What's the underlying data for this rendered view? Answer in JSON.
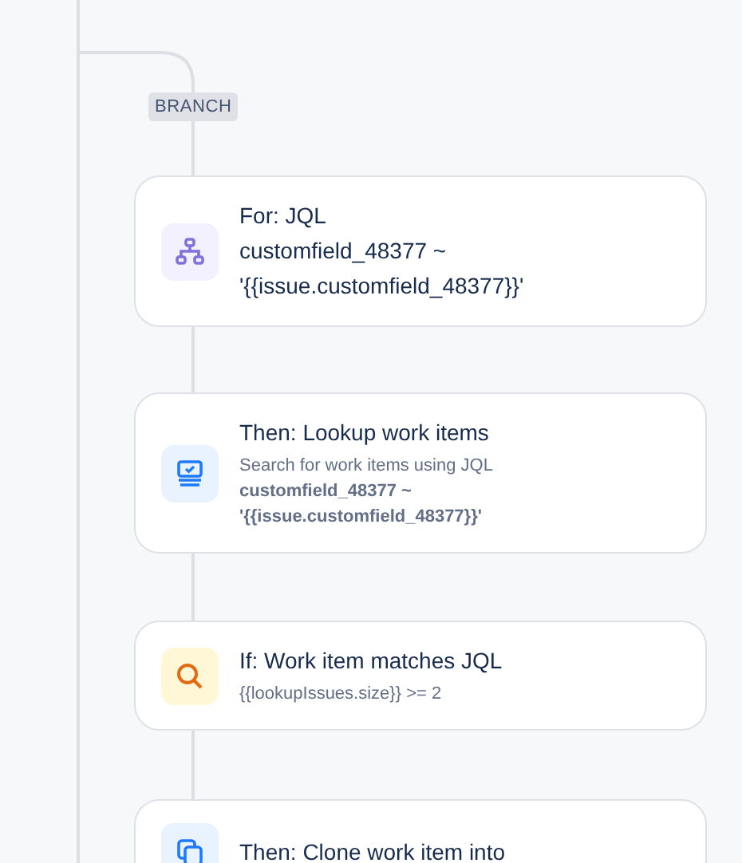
{
  "branch_label": "BRANCH",
  "steps": [
    {
      "kind": "for",
      "title": "For: JQL",
      "query": "customfield_48377 ~ '{{issue.customfield_48377}}'"
    },
    {
      "kind": "lookup",
      "title": "Then: Lookup work items",
      "description": "Search for work items using JQL",
      "query": "customfield_48377 ~ '{{issue.customfield_48377}}'"
    },
    {
      "kind": "condition",
      "title": "If: Work item matches JQL",
      "description": "{{lookupIssues.size}} >= 2"
    },
    {
      "kind": "clone",
      "title": "Then: Clone work item into"
    }
  ]
}
